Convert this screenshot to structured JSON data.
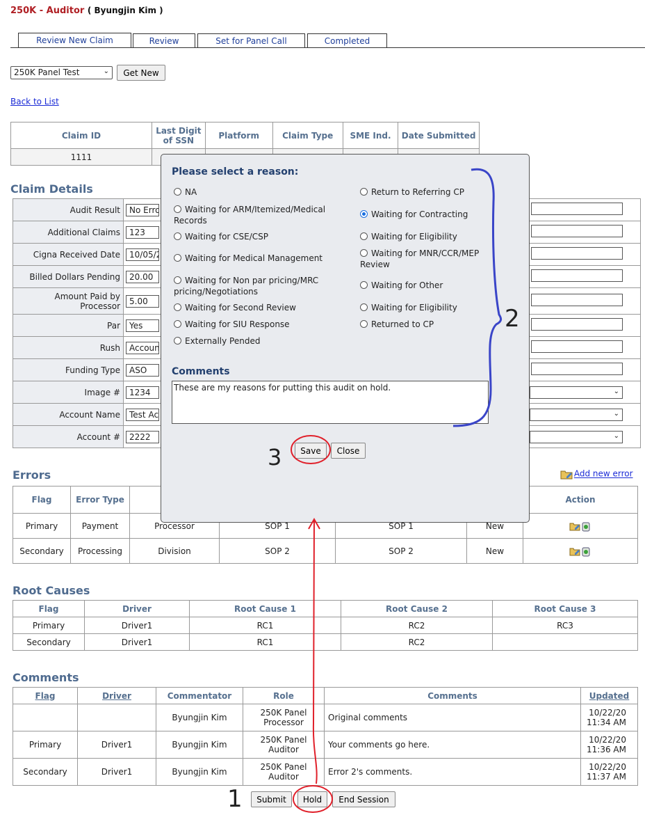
{
  "header": {
    "role": "250K - Auditor",
    "user": "( Byungjin Kim )"
  },
  "tabs": [
    "Review New Claim",
    "Review",
    "Set for Panel Call",
    "Completed"
  ],
  "queue": {
    "selected": "250K Panel Test",
    "get_new": "Get New"
  },
  "back_link": "Back to List",
  "claim_table": {
    "headers": [
      "Claim ID",
      "Last Digit of SSN",
      "Platform",
      "Claim Type",
      "SME Ind.",
      "Date Submitted"
    ],
    "row": [
      "1111",
      "",
      "",
      "",
      "",
      ""
    ]
  },
  "claim_details": {
    "title": "Claim Details",
    "rows": [
      {
        "label": "Audit Result",
        "value": "No Erro"
      },
      {
        "label": "Additional Claims",
        "value": "123"
      },
      {
        "label": "Cigna Received Date",
        "value": "10/05/2"
      },
      {
        "label": "Billed Dollars Pending",
        "value": "20.00"
      },
      {
        "label": "Amount Paid by Processor",
        "value": "5.00"
      },
      {
        "label": "Par",
        "value": "Yes"
      },
      {
        "label": "Rush",
        "value": "Accoun"
      },
      {
        "label": "Funding Type",
        "value": "ASO"
      },
      {
        "label": "Image #",
        "value": "1234"
      },
      {
        "label": "Account Name",
        "value": "Test Ac"
      },
      {
        "label": "Account #",
        "value": "2222"
      }
    ]
  },
  "errors": {
    "title": "Errors",
    "add_link": "Add new error",
    "headers": [
      "Flag",
      "Error Type",
      "Di",
      "",
      "",
      "",
      "Action"
    ],
    "rows": [
      [
        "Primary",
        "Payment",
        "Processor",
        "SOP 1",
        "SOP 1",
        "New"
      ],
      [
        "Secondary",
        "Processing",
        "Division",
        "SOP 2",
        "SOP 2",
        "New"
      ]
    ]
  },
  "root_causes": {
    "title": "Root Causes",
    "headers": [
      "Flag",
      "Driver",
      "Root Cause 1",
      "Root Cause 2",
      "Root Cause 3"
    ],
    "rows": [
      [
        "Primary",
        "Driver1",
        "RC1",
        "RC2",
        "RC3"
      ],
      [
        "Secondary",
        "Driver1",
        "RC1",
        "RC2",
        ""
      ]
    ]
  },
  "comments": {
    "title": "Comments",
    "headers": [
      "Flag",
      "Driver",
      "Commentator",
      "Role",
      "Comments",
      "Updated"
    ],
    "rows": [
      [
        "",
        "",
        "Byungjin Kim",
        "250K Panel Processor",
        "Original comments",
        "10/22/20 11:34 AM"
      ],
      [
        "Primary",
        "Driver1",
        "Byungjin Kim",
        "250K Panel Auditor",
        "Your comments go here.",
        "10/22/20 11:36 AM"
      ],
      [
        "Secondary",
        "Driver1",
        "Byungjin Kim",
        "250K Panel Auditor",
        "Error 2's comments.",
        "10/22/20 11:37 AM"
      ]
    ]
  },
  "footer_buttons": {
    "submit": "Submit",
    "hold": "Hold",
    "end": "End Session"
  },
  "modal": {
    "title": "Please select a reason:",
    "left_options": [
      "NA",
      "Waiting for ARM/Itemized/Medical Records",
      "Waiting for CSE/CSP",
      "Waiting for Medical Management",
      "Waiting for Non par pricing/MRC pricing/Negotiations",
      "Waiting for Second Review",
      "Waiting for SIU Response",
      "Externally Pended"
    ],
    "right_options": [
      "Return to Referring CP",
      "Waiting for Contracting",
      "Waiting for Eligibility",
      "Waiting for MNR/CCR/MEP Review",
      "Waiting for Other",
      "Waiting for Eligibility",
      "Returned to CP"
    ],
    "selected": "Waiting for Contracting",
    "comments_label": "Comments",
    "comments_value": "These are my reasons for putting this audit on hold.",
    "save": "Save",
    "close": "Close"
  },
  "annotations": {
    "n1": "1",
    "n2": "2",
    "n3": "3"
  },
  "colors": {
    "annotation_red": "#e0202a",
    "annotation_blue": "#3a45c8",
    "title_red": "#b01f24",
    "link_blue": "#1a2ad6"
  }
}
